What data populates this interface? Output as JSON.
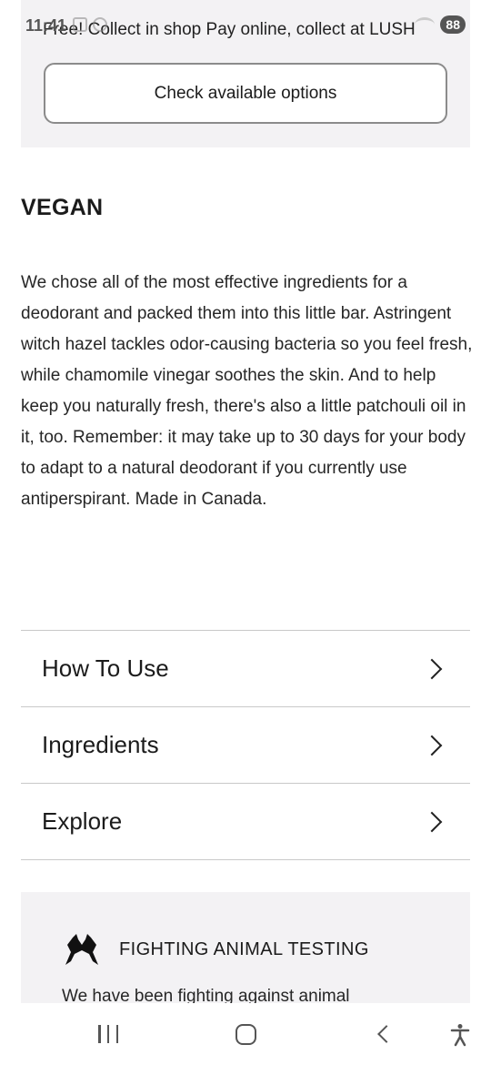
{
  "status_bar": {
    "time": "11:41",
    "battery": "88"
  },
  "collect": {
    "text": "Free! Collect in shop Pay online, collect at LUSH",
    "button_label": "Check available options"
  },
  "section": {
    "title": "VEGAN",
    "description": "We chose all of the most effective ingredients for a deodorant and packed them into this little bar. Astringent witch hazel tackles odor-causing bacteria so you feel fresh, while chamomile vinegar soothes the skin. And to help keep you naturally fresh, there's also a little patchouli oil in it, too. Remember: it may take up to 30 days for your body to adapt to a natural deodorant if you currently use antiperspirant. Made in Canada."
  },
  "accordion": {
    "items": [
      {
        "label": "How To Use",
        "icon": "chevron-right-icon"
      },
      {
        "label": "Ingredients",
        "icon": "chevron-right-icon"
      },
      {
        "label": "Explore",
        "icon": "chevron-right-icon"
      }
    ]
  },
  "animal_testing": {
    "icon": "fighting-animals-logo-icon",
    "title": "FIGHTING ANIMAL TESTING",
    "text": "We have been fighting against animal"
  },
  "nav_bar": {
    "icons": [
      "recent-apps-icon",
      "home-icon",
      "back-icon",
      "accessibility-icon"
    ]
  }
}
